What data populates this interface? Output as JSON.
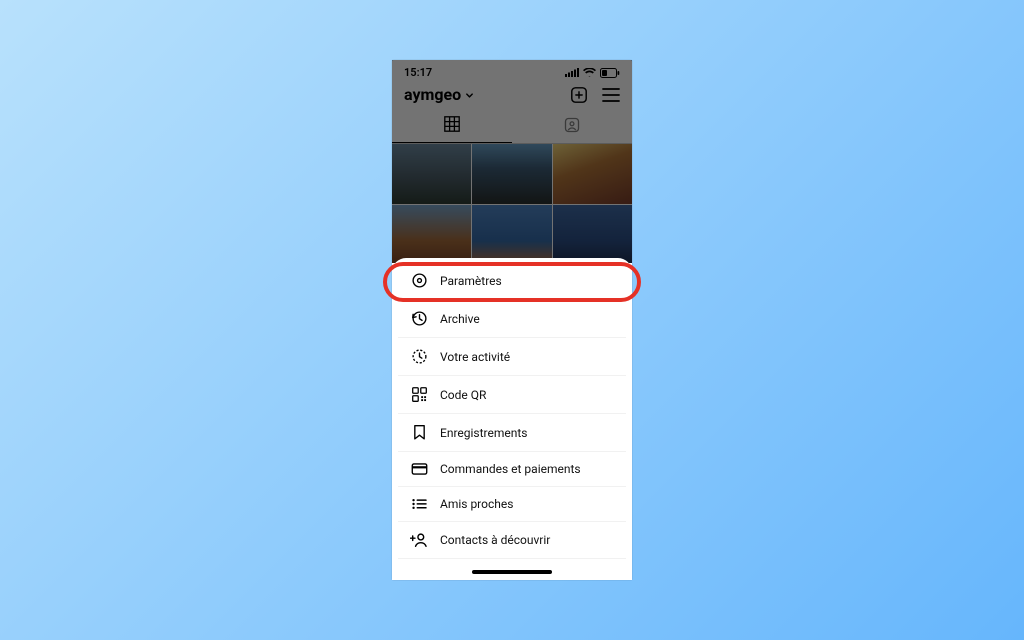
{
  "status": {
    "time": "15:17"
  },
  "profile": {
    "username": "aymgeo"
  },
  "menu": {
    "items": [
      {
        "label": "Paramètres"
      },
      {
        "label": "Archive"
      },
      {
        "label": "Votre activité"
      },
      {
        "label": "Code QR"
      },
      {
        "label": "Enregistrements"
      },
      {
        "label": "Commandes et paiements"
      },
      {
        "label": "Amis proches"
      },
      {
        "label": "Contacts à découvrir"
      }
    ]
  },
  "highlight": {
    "color": "#e53126"
  }
}
